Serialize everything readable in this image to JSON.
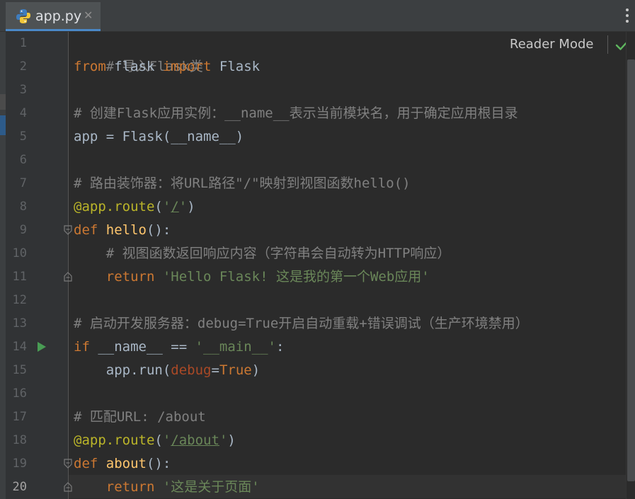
{
  "tab": {
    "filename": "app.py",
    "close_glyph": "✕",
    "icon": "python-file-icon"
  },
  "reader_mode": {
    "label": "Reader Mode",
    "status_icon": "check-icon"
  },
  "current_line": 20,
  "line_numbers": [
    "1",
    "2",
    "3",
    "4",
    "5",
    "6",
    "7",
    "8",
    "9",
    "10",
    "11",
    "12",
    "13",
    "14",
    "15",
    "16",
    "17",
    "18",
    "19",
    "20"
  ],
  "code": {
    "l1_comment": "# 导入Flask类",
    "l2_from": "from",
    "l2_mod": " flask ",
    "l2_import": "import",
    "l2_name": " Flask",
    "l4_comment": "# 创建Flask应用实例：__name__表示当前模块名，用于确定应用根目录",
    "l5_code": "app = Flask(__name__)",
    "l7_comment": "# 路由装饰器：将URL路径\"/\"映射到视图函数hello()",
    "l8_deco": "@app.route",
    "l8_open": "(",
    "l8_q1": "'",
    "l8_path": "/",
    "l8_q2": "'",
    "l8_close": ")",
    "l9_def": "def",
    "l9_name": " hello",
    "l9_rest": "():",
    "l10_comment": "    # 视图函数返回响应内容（字符串会自动转为HTTP响应）",
    "l11_return": "    return",
    "l11_str": " 'Hello Flask! 这是我的第一个Web应用'",
    "l13_comment": "# 启动开发服务器：debug=True开启自动重载+错误调试（生产环境禁用）",
    "l14_if": "if",
    "l14_mid": " __name__ == ",
    "l14_str": "'__main__'",
    "l14_colon": ":",
    "l15_pre": "    app.run(",
    "l15_param": "debug",
    "l15_eq": "=",
    "l15_true": "True",
    "l15_close": ")",
    "l17_comment": "# 匹配URL: /about",
    "l18_deco": "@app.route",
    "l18_open": "(",
    "l18_q1": "'",
    "l18_path": "/about",
    "l18_q2": "'",
    "l18_close": ")",
    "l19_def": "def",
    "l19_name": " about",
    "l19_rest": "():",
    "l20_return": "    return",
    "l20_str": " '这是关于页面'"
  },
  "colors": {
    "keyword": "#cc7832",
    "comment": "#808080",
    "string": "#6a8759",
    "function": "#ffc66d",
    "decorator": "#bbb529",
    "param": "#aa4926",
    "text": "#a9b7c6",
    "run_icon": "#499c54",
    "check_icon": "#5fb85f"
  }
}
